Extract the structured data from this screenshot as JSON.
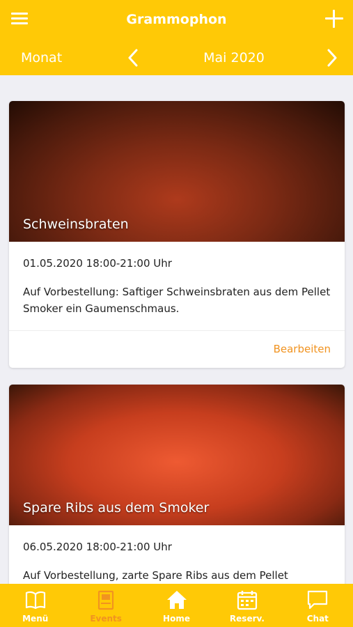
{
  "header": {
    "title": "Grammophon"
  },
  "month_bar": {
    "label": "Monat",
    "value": "Mai 2020"
  },
  "events": [
    {
      "title": "Schweinsbraten",
      "date": "01.05.2020 18:00-21:00 Uhr",
      "description": "Auf Vorbestellung: Saftiger Schweinsbraten aus dem Pellet Smoker ein Gaumenschmaus.",
      "action": "Bearbeiten"
    },
    {
      "title": "Spare Ribs aus dem Smoker",
      "date": "06.05.2020 18:00-21:00 Uhr",
      "description": "Auf Vorbestellung, zarte Spare Ribs aus dem Pellet Smoker"
    }
  ],
  "tabs": [
    {
      "label": "Menü",
      "icon": "book-icon"
    },
    {
      "label": "Events",
      "icon": "events-icon",
      "active": true
    },
    {
      "label": "Home",
      "icon": "home-icon"
    },
    {
      "label": "Reserv.",
      "icon": "calendar-icon"
    },
    {
      "label": "Chat",
      "icon": "chat-icon"
    }
  ],
  "colors": {
    "primary": "#ffc906",
    "accent": "#f19320",
    "background": "#efeff4"
  }
}
